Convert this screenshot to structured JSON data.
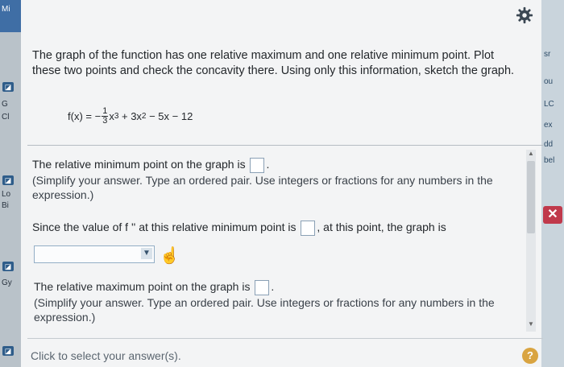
{
  "left_strip": {
    "top_label": "Mi",
    "labels": [
      "G",
      "Cl",
      "Lo",
      "Bi",
      "Gy"
    ]
  },
  "right_strip": {
    "labels": [
      "sr",
      "ou",
      "LC",
      "ex",
      "dd",
      "bel"
    ]
  },
  "question": {
    "prompt": "The graph of the function has one relative maximum and one relative minimum point. Plot these two points and check the concavity there. Using only this information, sketch the graph.",
    "function_lhs": "f(x) = −",
    "fraction_num": "1",
    "fraction_den": "3",
    "function_rest_1": "x",
    "exp_3": "3",
    "function_rest_2": " + 3x",
    "exp_2": "2",
    "function_rest_3": " − 5x − 12"
  },
  "part1": {
    "text": "The relative minimum point on the graph is",
    "hint": "(Simplify your answer. Type an ordered pair. Use integers or fractions for any numbers in the expression.)"
  },
  "part2": {
    "text_before": "Since the value of f '' at this relative minimum point is",
    "text_after": ", at this point, the graph is"
  },
  "part3": {
    "text": "The relative maximum point on the graph is",
    "hint": "(Simplify your answer. Type an ordered pair. Use integers or fractions for any numbers in the expression.)"
  },
  "footer": {
    "text": "Click to select your answer(s).",
    "help": "?"
  },
  "colors": {
    "panel_bg": "#f3f4f5",
    "accent": "#93aec6",
    "help": "#d9a441"
  }
}
